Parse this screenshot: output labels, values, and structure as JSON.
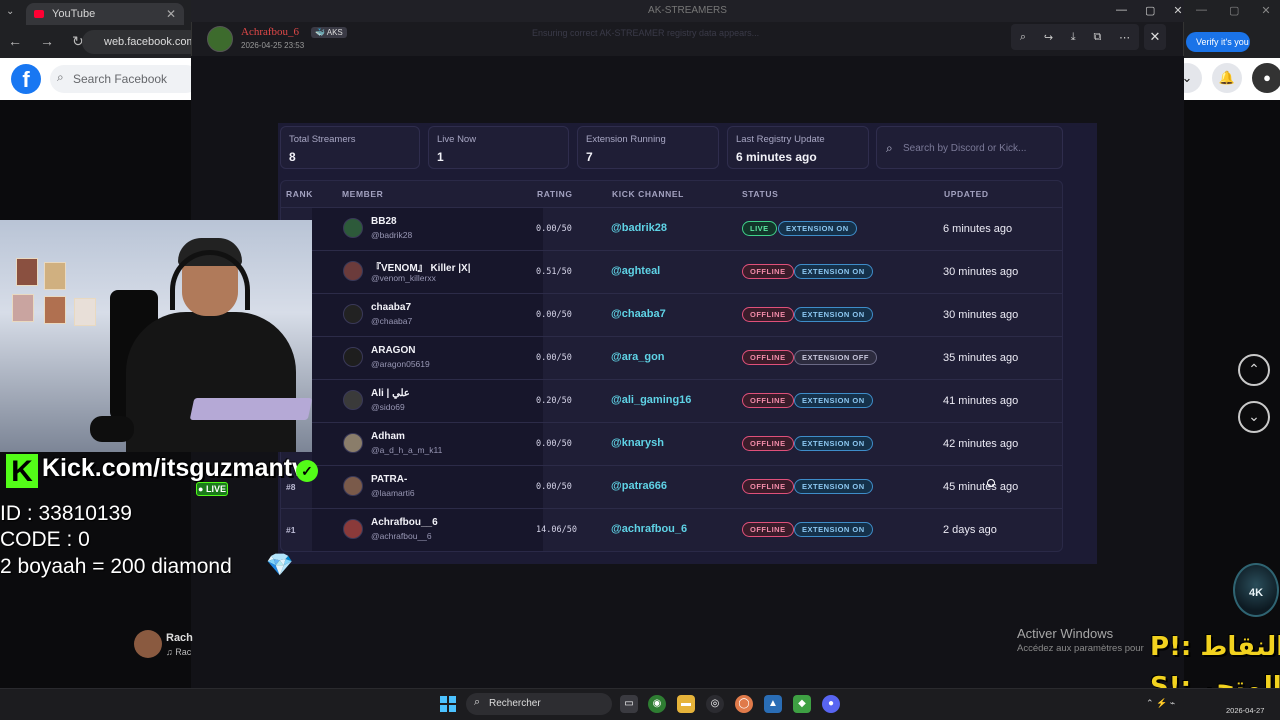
{
  "browser": {
    "tab_title": "YouTube",
    "tab_close": "✕",
    "url": "web.facebook.com/re",
    "verify_pill": "Verify it's you",
    "nav_back": "←",
    "nav_forward": "→",
    "nav_reload": "↻"
  },
  "facebook": {
    "logo": "f",
    "search_placeholder": "Search Facebook"
  },
  "stream_overlay": {
    "kick_logo_letter": "K",
    "kick_url": "Kick.com/itsguzmantv",
    "live_badge": "● LIVE",
    "id_line": "ID : 33810139",
    "code_line": "CODE : 0",
    "offer_line": "2 boyaah = 200 diamond",
    "diamond_icon": "gem-icon",
    "profile_name": "Rach",
    "profile_sub": "♫ Rac"
  },
  "viewer": {
    "window_title": "AK-STREAMERS",
    "author_name": "Achrafbou_6",
    "author_tag": "🐳 AKS",
    "author_date": "2026-04-25 23:53",
    "faded_banner": "Ensuring correct AK-STREAMER registry data appears...",
    "close_symbol": "✕"
  },
  "dashboard": {
    "stats": [
      {
        "label": "Total Streamers",
        "value": "8"
      },
      {
        "label": "Live Now",
        "value": "1"
      },
      {
        "label": "Extension Running",
        "value": "7"
      },
      {
        "label": "Last Registry Update",
        "value": "6 minutes ago"
      }
    ],
    "search_placeholder": "Search by Discord or Kick...",
    "columns": {
      "rank": "RANK",
      "member": "MEMBER",
      "rating": "RATING",
      "kick": "KICK CHANNEL",
      "status": "STATUS",
      "updated": "UPDATED"
    },
    "rows": [
      {
        "rank": "",
        "name": "BB28",
        "handle": "@badrik28",
        "rating": "0.00/50",
        "kick": "@badrik28",
        "status": "LIVE",
        "extension": "EXTENSION ON",
        "updated": "6 minutes ago",
        "avatar_color": "#2d5a3a"
      },
      {
        "rank": "",
        "name": "『VENOM』 Killer |X|",
        "handle": "@venom_killerxx",
        "rating": "0.51/50",
        "kick": "@aghteal",
        "status": "OFFLINE",
        "extension": "EXTENSION ON",
        "updated": "30 minutes ago",
        "avatar_color": "#6b3b3b"
      },
      {
        "rank": "",
        "name": "chaaba7",
        "handle": "@chaaba7",
        "rating": "0.00/50",
        "kick": "@chaaba7",
        "status": "OFFLINE",
        "extension": "EXTENSION ON",
        "updated": "30 minutes ago",
        "avatar_color": "#222222"
      },
      {
        "rank": "",
        "name": "ARAGON",
        "handle": "@aragon05619",
        "rating": "0.00/50",
        "kick": "@ara_gon",
        "status": "OFFLINE",
        "extension": "EXTENSION OFF",
        "updated": "35 minutes ago",
        "avatar_color": "#1e1e1e"
      },
      {
        "rank": "",
        "name": "Ali | علي",
        "handle": "@sido69",
        "rating": "0.20/50",
        "kick": "@ali_gaming16",
        "status": "OFFLINE",
        "extension": "EXTENSION ON",
        "updated": "41 minutes ago",
        "avatar_color": "#3a3a3a"
      },
      {
        "rank": "",
        "name": "Adham",
        "handle": "@a_d_h_a_m_k11",
        "rating": "0.00/50",
        "kick": "@knarysh",
        "status": "OFFLINE",
        "extension": "EXTENSION ON",
        "updated": "42 minutes ago",
        "avatar_color": "#8a7d6a"
      },
      {
        "rank": "#8",
        "name": "PATRA-",
        "handle": "@laamarti6",
        "rating": "0.00/50",
        "kick": "@patra666",
        "status": "OFFLINE",
        "extension": "EXTENSION ON",
        "updated": "45 minutes ago",
        "avatar_color": "#7a5a4a"
      },
      {
        "rank": "#1",
        "name": "Achrafbou__6",
        "handle": "@achrafbou__6",
        "rating": "14.06/50",
        "kick": "@achrafbou_6",
        "status": "OFFLINE",
        "extension": "EXTENSION ON",
        "updated": "2 days ago",
        "avatar_color": "#8a3a3a"
      }
    ]
  },
  "desktop": {
    "activate_title": "Activer Windows",
    "activate_sub": "Accédez aux paramètres pour",
    "arabic_line_1": "النقاط :!P",
    "arabic_line_2": "المتجر :!S",
    "ak_logo_text": "4K",
    "arrow_up": "⌃",
    "arrow_down": "⌄"
  },
  "taskbar": {
    "search_label": "Rechercher",
    "date": "2026-04-27"
  }
}
